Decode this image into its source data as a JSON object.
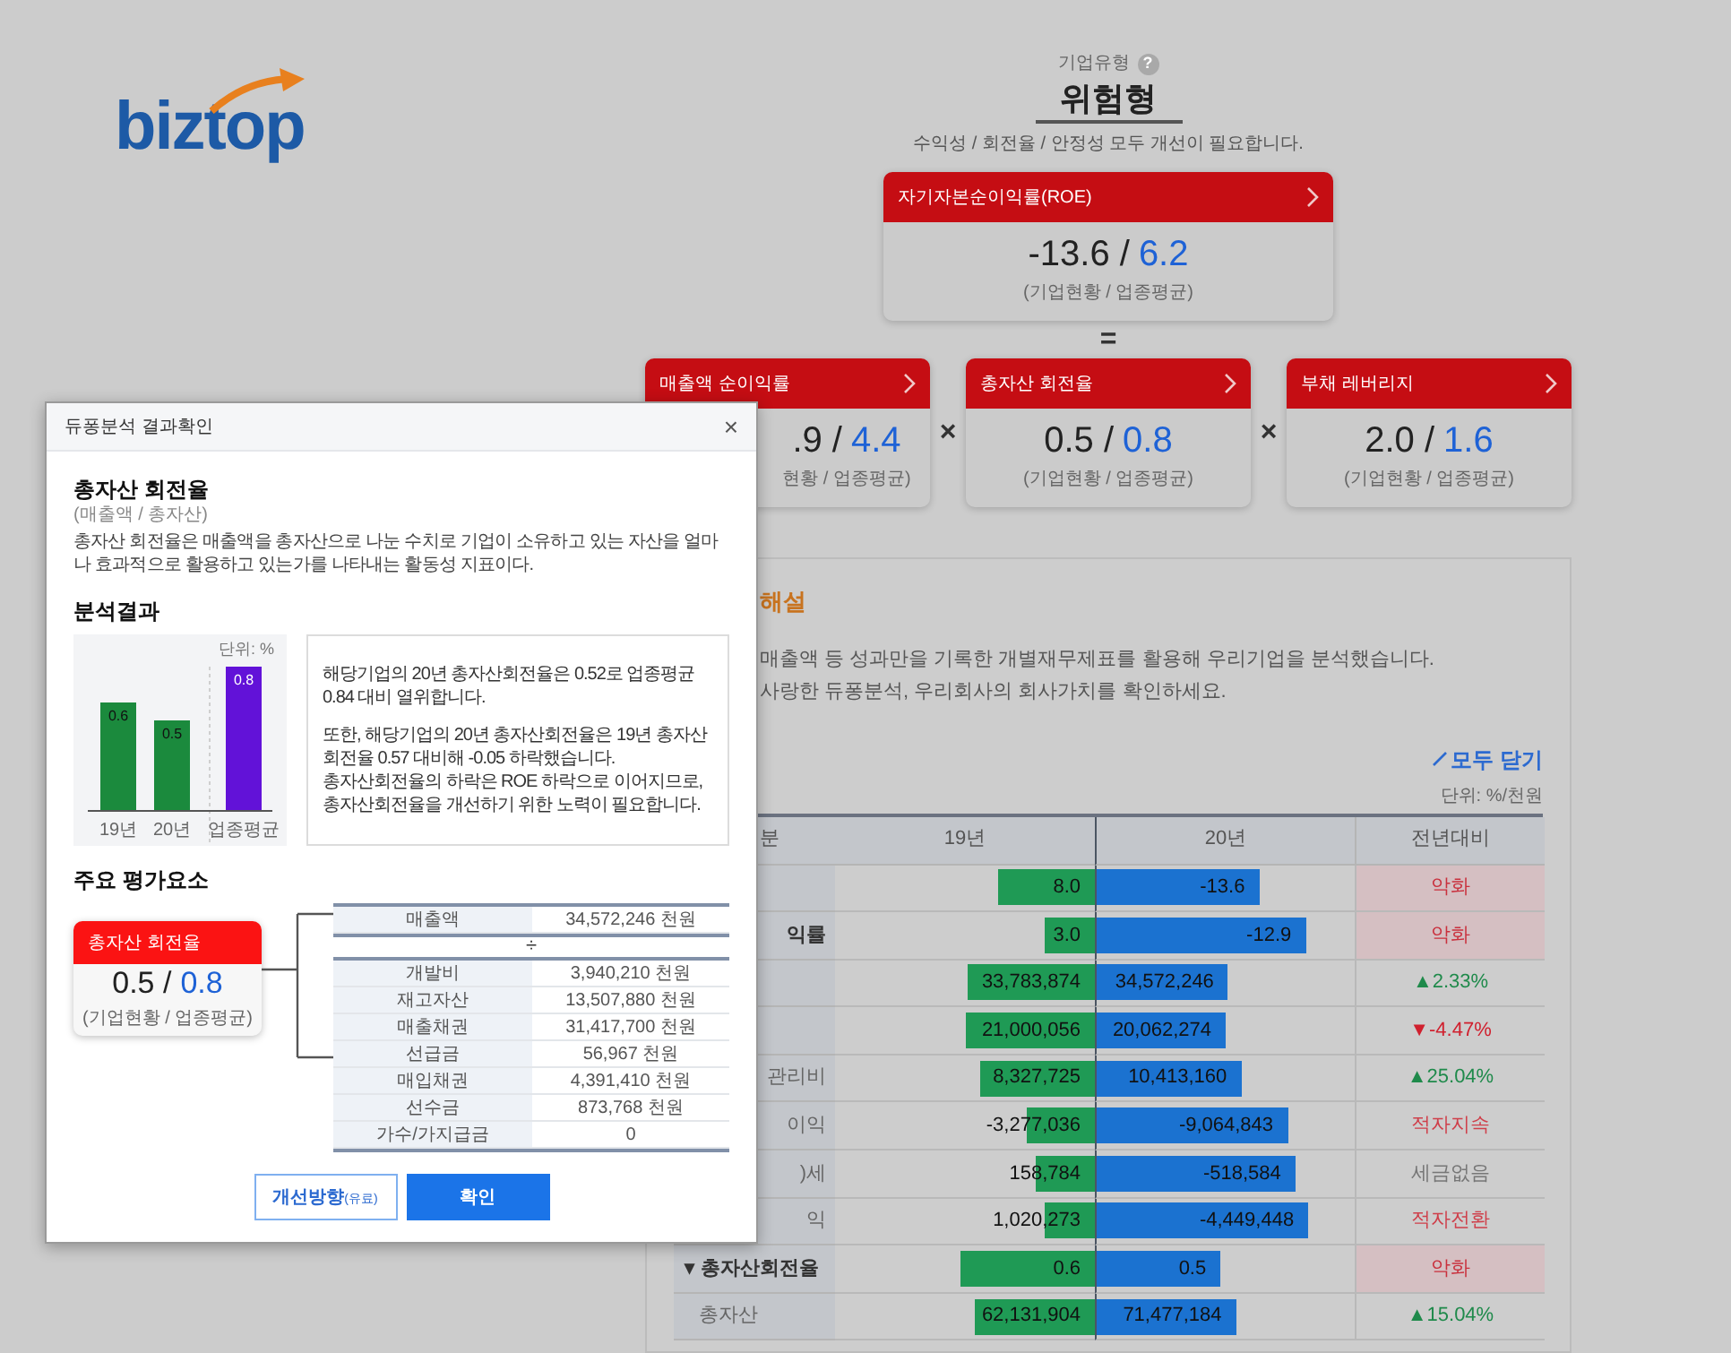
{
  "logo": {
    "text": "biztop"
  },
  "company_type": {
    "label": "기업유형",
    "help": "?",
    "value": "위험형",
    "summary": "수익성 / 회전율 / 안정성 모두 개선이 필요합니다."
  },
  "roe_card": {
    "title": "자기자본순이익률(ROE)",
    "company": "-13.6 /",
    "average": "6.2",
    "caption": "(기업현황 / 업종평균)"
  },
  "equals": "=",
  "factor_cards": [
    {
      "title": "매출액 순이익률",
      "company": ".9 /",
      "average": "4.4",
      "caption": "현황 / 업종평균)"
    },
    {
      "title": "총자산 회전율",
      "company": "0.5 /",
      "average": "0.8",
      "caption": "(기업현황 / 업종평균)"
    },
    {
      "title": "부채 레버리지",
      "company": "2.0 /",
      "average": "1.6",
      "caption": "(기업현황 / 업종평균)"
    }
  ],
  "operators": [
    "×",
    "×"
  ],
  "panel": {
    "title": "해설",
    "lines": [
      "매출액 등 성과만을 기록한 개별재무제표를 활용해 우리기업을 분석했습니다.",
      "사랑한 듀퐁분석, 우리회사의 회사가치를 확인하세요."
    ],
    "collapse_all": "모두 닫기",
    "unit": "단위: %/천원",
    "columns": [
      "분",
      "19년",
      "20년",
      "전년대비"
    ],
    "rows": [
      {
        "y19": {
          "text": "8.0",
          "level": 0.37
        },
        "y20": {
          "text": "-13.6",
          "level": 0.63
        },
        "change": {
          "text": "악화",
          "color": "#c9303d",
          "highlighted": true
        }
      },
      {
        "label": "익률",
        "bold": true,
        "y19": {
          "text": "3.0",
          "level": 0.19
        },
        "y20": {
          "text": "-12.9",
          "level": 0.81
        },
        "change": {
          "text": "악화",
          "color": "#c9303d",
          "highlighted": true
        }
      },
      {
        "y19": {
          "text": "33,783,874",
          "level": 0.49
        },
        "y20": {
          "text": "34,572,246",
          "level": 0.51
        },
        "change": {
          "text": "▲2.33%",
          "color": "#1f8a4b",
          "highlighted": false
        }
      },
      {
        "y19": {
          "text": "21,000,056",
          "level": 0.5
        },
        "y20": {
          "text": "20,062,274",
          "level": 0.5
        },
        "change": {
          "text": "▼-4.47%",
          "color": "#d0202e",
          "highlighted": false
        }
      },
      {
        "label": "관리비",
        "bold": false,
        "y19": {
          "text": "8,327,725",
          "level": 0.44
        },
        "y20": {
          "text": "10,413,160",
          "level": 0.56
        },
        "change": {
          "text": "▲25.04%",
          "color": "#1f8a4b",
          "highlighted": false
        }
      },
      {
        "label": "이익",
        "bold": false,
        "y19": {
          "text": "-3,277,036",
          "level": 0.26
        },
        "y20": {
          "text": "-9,064,843",
          "level": 0.74
        },
        "change": {
          "text": "적자지속",
          "color": "#cf3f4a",
          "highlighted": false
        }
      },
      {
        "label": ")세",
        "bold": false,
        "y19": {
          "text": "158,784",
          "level": 0.23
        },
        "y20": {
          "text": "-518,584",
          "level": 0.77
        },
        "change": {
          "text": "세금없음",
          "color": "#777777",
          "highlighted": false
        }
      },
      {
        "label": "익",
        "bold": false,
        "y19": {
          "text": "1,020,273",
          "level": 0.19
        },
        "y20": {
          "text": "-4,449,448",
          "level": 0.82
        },
        "change": {
          "text": "적자전환",
          "color": "#cf3f4a",
          "highlighted": false
        }
      },
      {
        "label": "▾ 총자산회전율",
        "bold": true,
        "y19": {
          "text": "0.6",
          "level": 0.52
        },
        "y20": {
          "text": "0.5",
          "level": 0.48
        },
        "change": {
          "text": "악화",
          "color": "#c9303d",
          "highlighted": true
        }
      },
      {
        "label": "총자산",
        "bold": false,
        "y19": {
          "text": "62,131,904",
          "level": 0.46
        },
        "y20": {
          "text": "71,477,184",
          "level": 0.54
        },
        "change": {
          "text": "▲15.04%",
          "color": "#1f8a4b",
          "highlighted": false
        }
      }
    ]
  },
  "modal": {
    "title": "듀퐁분석 결과확인",
    "close": "×",
    "heading": "총자산 회전율",
    "formula": "(매출액 / 총자산)",
    "description": "총자산 회전율은 매출액을 총자산으로 나눈 수치로 기업이 소유하고 있는 자산을 얼마나 효과적으로 활용하고 있는가를 나타내는 활동성 지표이다.",
    "result_title": "분석결과",
    "chart_unit": "단위: %",
    "chart_data": {
      "type": "bar",
      "categories": [
        "19년",
        "20년",
        "업종평균"
      ],
      "series": [
        {
          "color": "#1b8a3d",
          "values": [
            0.6,
            0.5,
            null
          ]
        },
        {
          "color": "#6212d8",
          "values": [
            null,
            null,
            0.8
          ]
        }
      ],
      "stacked": true,
      "data_labels": true
    },
    "analysis": [
      "해당기업의 20년 총자산회전율은 0.52로 업종평균 0.84 대비 열위합니다.",
      "또한, 해당기업의 20년 총자산회전율은 19년 총자산회전율 0.57 대비해 -0.05 하락했습니다.",
      "총자산회전율의 하락은 ROE 하락으로 이어지므로, 총자산회전율을 개선하기 위한 노력이 필요합니다."
    ],
    "factors_title": "주요 평가요소",
    "card": {
      "title": "총자산 회전율",
      "company": "0.5 /",
      "average": "0.8",
      "caption": "(기업현황 / 업종평균)"
    },
    "numerator": {
      "label": "매출액",
      "value": "34,572,246 천원"
    },
    "divide": "÷",
    "denominator": [
      {
        "label": "개발비",
        "value": "3,940,210 천원"
      },
      {
        "label": "재고자산",
        "value": "13,507,880 천원"
      },
      {
        "label": "매출채권",
        "value": "31,417,700 천원"
      },
      {
        "label": "선급금",
        "value": "56,967 천원"
      },
      {
        "label": "매입채권",
        "value": "4,391,410 천원"
      },
      {
        "label": "선수금",
        "value": "873,768 천원"
      },
      {
        "label": "가수/가지급금",
        "value": "0"
      }
    ],
    "buttons": [
      {
        "kind": "secondary",
        "label": "개선방향",
        "note": "(유료)"
      },
      {
        "kind": "primary",
        "label": "확인"
      }
    ]
  }
}
